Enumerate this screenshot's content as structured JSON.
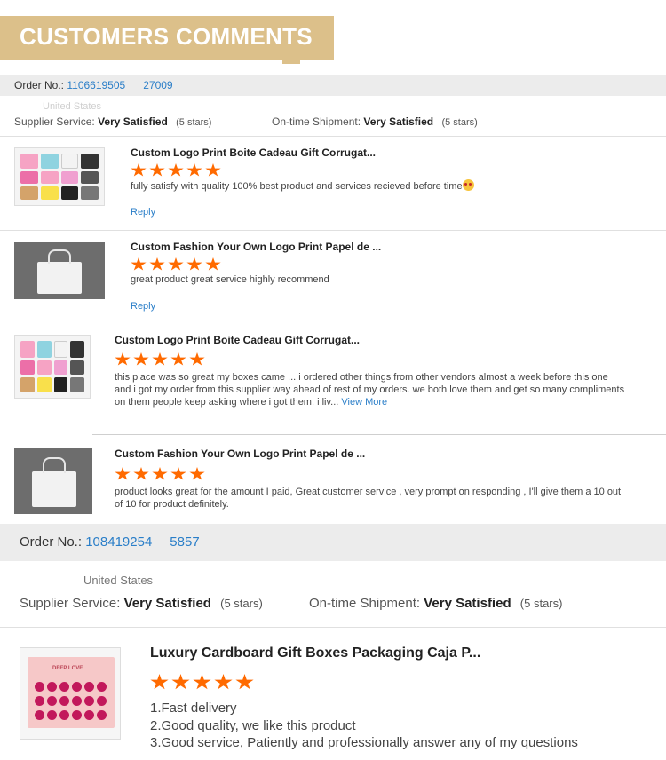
{
  "header": {
    "title": "CUSTOMERS COMMENTS"
  },
  "order1": {
    "label": "Order No.:",
    "number_start": "1106619505",
    "number_end": "27009",
    "buyer": "United States",
    "supplier_label": "Supplier Service:",
    "supplier_value": "Very Satisfied",
    "supplier_stars": "(5 stars)",
    "shipment_label": "On-time Shipment:",
    "shipment_value": "Very Satisfied",
    "shipment_stars": "(5 stars)"
  },
  "reviews": [
    {
      "title": "Custom Logo Print Boite Cadeau Gift Corrugat...",
      "rating": 5,
      "comment": "fully satisfy  with quality 100% best product and services recieved before time",
      "reply_label": "Reply",
      "thumb_icon": "colored-mailer-boxes-image"
    },
    {
      "title": "Custom Fashion Your Own Logo Print Papel de ...",
      "rating": 5,
      "comment": "great product great service highly recommend",
      "reply_label": "Reply",
      "thumb_icon": "white-paper-bag-image"
    },
    {
      "title": "Custom Logo Print Boite Cadeau Gift Corrugat...",
      "rating": 5,
      "comment": "this place was so great my boxes came ... i ordered other things from other vendors almost a week before this one and i got my order from this supplier way ahead of rest of my orders. we both love them and get so many compliments on them people keep asking where i got them. i liv...",
      "more_label": "View More",
      "thumb_icon": "colored-mailer-boxes-image"
    },
    {
      "title": "Custom Fashion Your Own Logo Print Papel de ...",
      "rating": 5,
      "comment": "product looks great for the amount I paid, Great customer service , very prompt on responding , I'll give them a 10 out of 10 for product definitely.",
      "thumb_icon": "white-paper-bag-image"
    }
  ],
  "order2": {
    "label": "Order No.:",
    "number_start": "108419254",
    "number_end": "5857",
    "buyer": "United States",
    "supplier_label": "Supplier Service:",
    "supplier_value": "Very Satisfied",
    "supplier_stars": "(5 stars)",
    "shipment_label": "On-time Shipment:",
    "shipment_value": "Very Satisfied",
    "shipment_stars": "(5 stars)"
  },
  "review5": {
    "title": "Luxury Cardboard Gift Boxes Packaging Caja P...",
    "rating": 5,
    "lines": [
      "1.Fast delivery",
      "2.Good quality, we like this product",
      "3.Good service, Patiently and professionally answer any of my questions"
    ],
    "lid_text": "DEEP LOVE",
    "thumb_icon": "rose-gift-box-image"
  },
  "colors": {
    "accent": "#ff6a00",
    "link": "#2a7ec8",
    "banner": "#dcc08a",
    "bar": "#ececec"
  }
}
